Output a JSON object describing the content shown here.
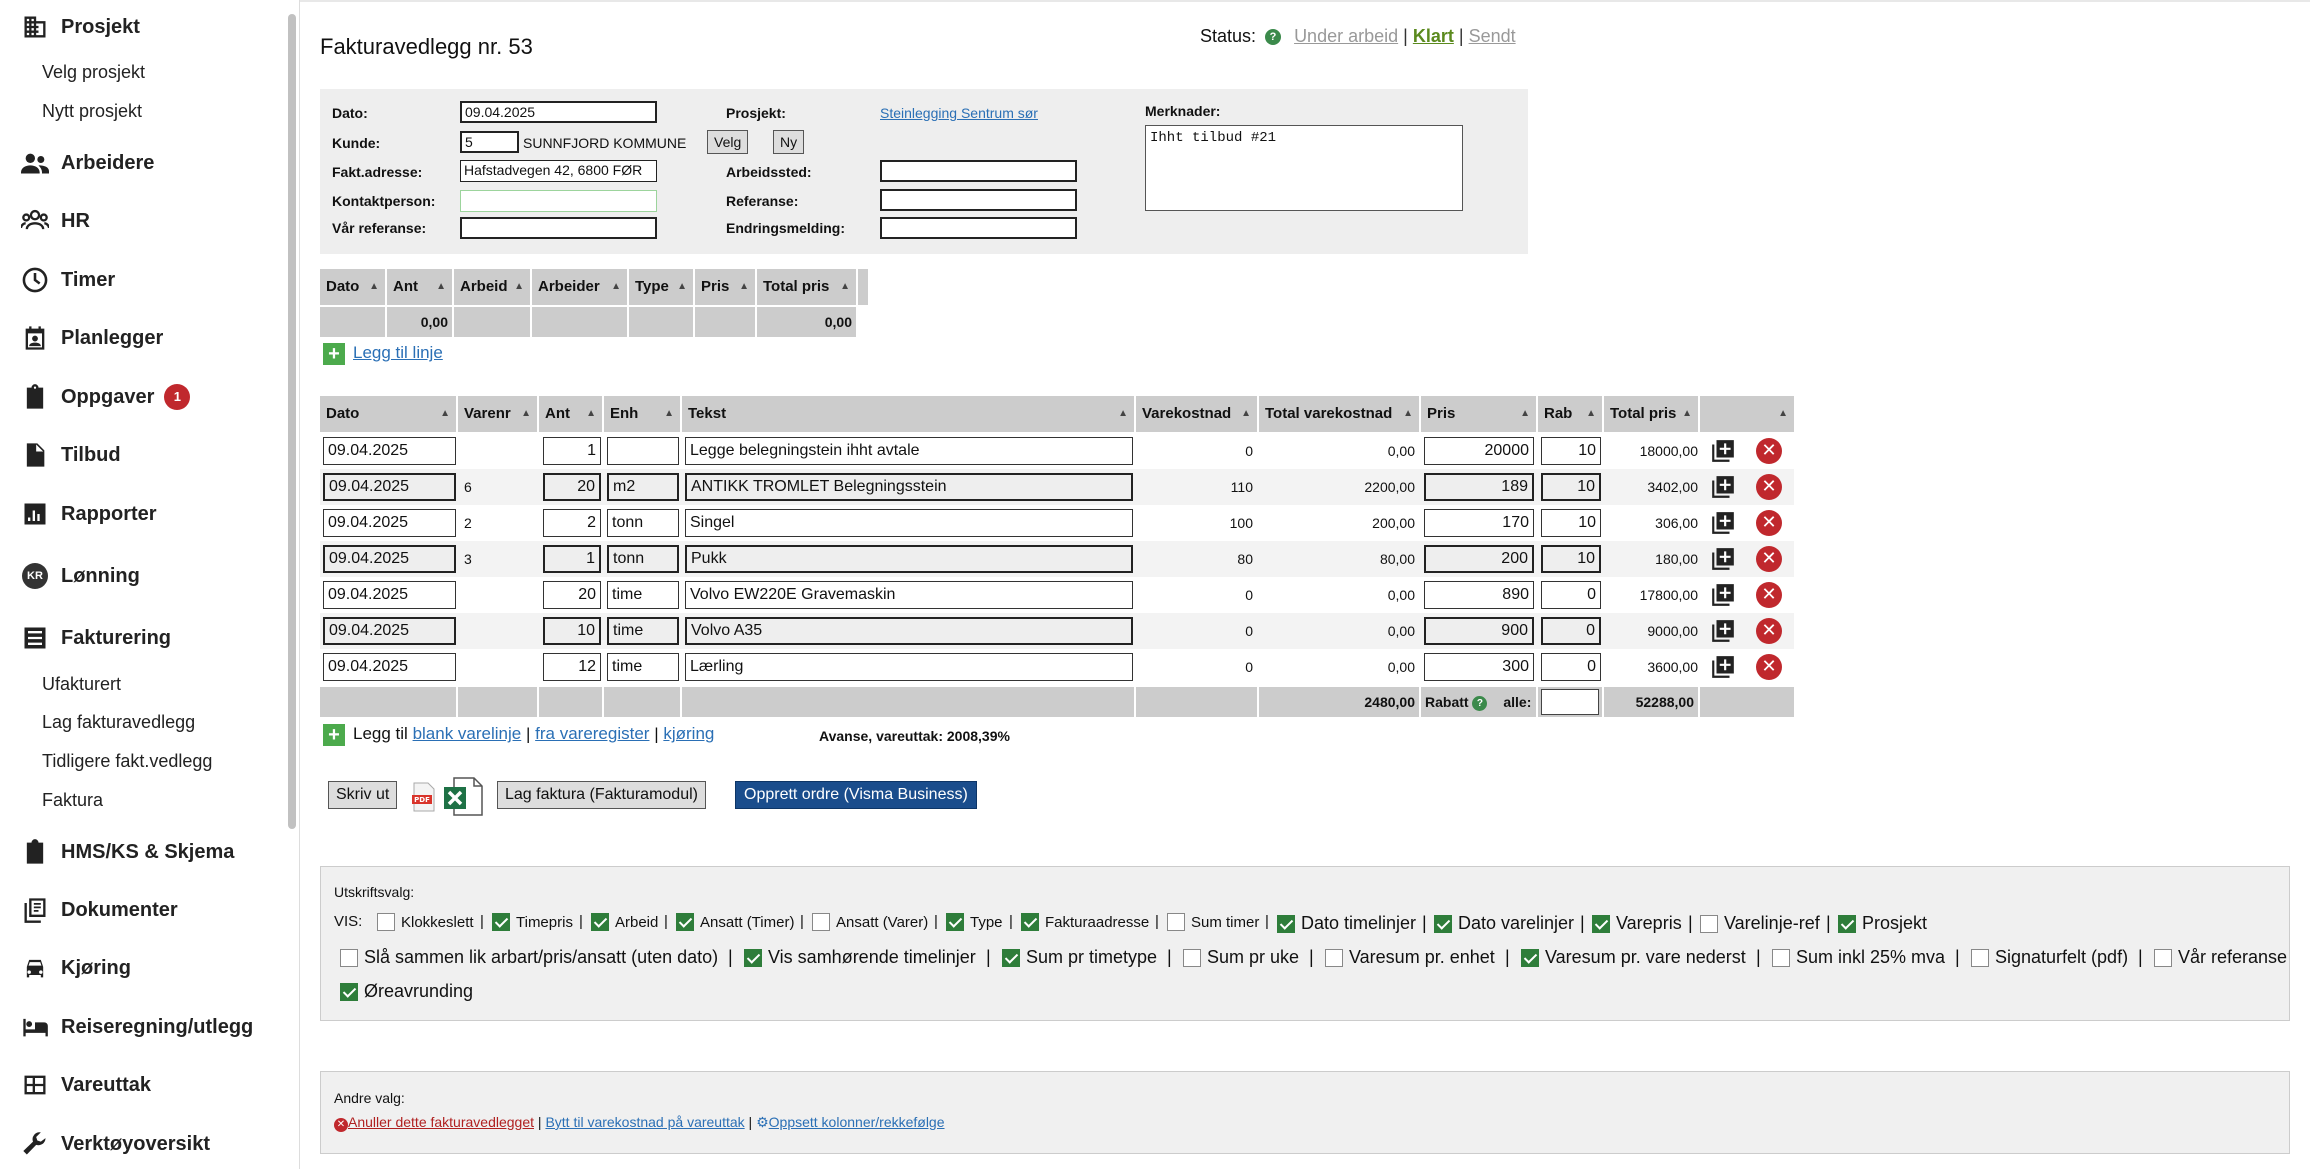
{
  "sidebar": {
    "items": [
      {
        "label": "Prosjekt",
        "icon": "building-icon"
      },
      {
        "label": "Arbeidere",
        "icon": "people-icon"
      },
      {
        "label": "HR",
        "icon": "group-icon"
      },
      {
        "label": "Timer",
        "icon": "clock-icon"
      },
      {
        "label": "Planlegger",
        "icon": "calendar-person-icon"
      },
      {
        "label": "Oppgaver",
        "icon": "task-icon",
        "badge": "1"
      },
      {
        "label": "Tilbud",
        "icon": "document-icon"
      },
      {
        "label": "Rapporter",
        "icon": "bar-chart-icon"
      },
      {
        "label": "Lønning",
        "icon": "kr-icon",
        "icon_text": "KR"
      },
      {
        "label": "Fakturering",
        "icon": "list-icon"
      },
      {
        "label": "HMS/KS & Skjema",
        "icon": "checkbox-icon"
      },
      {
        "label": "Dokumenter",
        "icon": "documents-icon"
      },
      {
        "label": "Kjøring",
        "icon": "car-icon"
      },
      {
        "label": "Reiseregning/utlegg",
        "icon": "bed-icon"
      },
      {
        "label": "Vareuttak",
        "icon": "grid-icon"
      },
      {
        "label": "Verktøyoversikt",
        "icon": "wrench-icon"
      }
    ],
    "prosjekt_sub": [
      "Velg prosjekt",
      "Nytt prosjekt"
    ],
    "fakturering_sub": [
      "Ufakturert",
      "Lag fakturavedlegg",
      "Tidligere fakt.vedlegg",
      "Faktura"
    ]
  },
  "page": {
    "title": "Fakturavedlegg nr. 53"
  },
  "status": {
    "label": "Status:",
    "help": "?",
    "options": [
      "Under arbeid",
      "Klart",
      "Sendt"
    ],
    "active": "Klart",
    "sep": "|"
  },
  "header": {
    "dato_label": "Dato:",
    "dato_value": "09.04.2025",
    "kunde_label": "Kunde:",
    "kunde_nr": "5",
    "kunde_navn": "SUNNFJORD KOMMUNE",
    "velg_btn": "Velg",
    "ny_btn": "Ny",
    "faktadresse_label": "Fakt.adresse:",
    "faktadresse_value": "Hafstadvegen 42, 6800 FØR",
    "kontaktperson_label": "Kontaktperson:",
    "kontaktperson_value": "",
    "var_referanse_label": "Vår referanse:",
    "var_referanse_value": "",
    "prosjekt_label": "Prosjekt:",
    "prosjekt_value": "Steinlegging Sentrum sør",
    "arbeidssted_label": "Arbeidssted:",
    "arbeidssted_value": "",
    "referanse_label": "Referanse:",
    "referanse_value": "",
    "endringsmelding_label": "Endringsmelding:",
    "endringsmelding_value": "",
    "merknader_label": "Merknader:",
    "merknader_value": "Ihht tilbud #21"
  },
  "time_table": {
    "headers": [
      "Dato",
      "Ant",
      "Arbeid",
      "Arbeider",
      "Type",
      "Pris",
      "Total pris"
    ],
    "sum_ant": "0,00",
    "sum_total": "0,00",
    "add_label": "Legg til linje"
  },
  "line_table": {
    "headers": [
      "Dato",
      "Varenr",
      "Ant",
      "Enh",
      "Tekst",
      "Varekostnad",
      "Total varekostnad",
      "Pris",
      "Rab",
      "Total pris",
      ""
    ],
    "rows": [
      {
        "dato": "09.04.2025",
        "varenr": "",
        "ant": "1",
        "enh": "",
        "tekst": "Legge belegningstein ihht avtale",
        "varekostnad": "0",
        "total_varekostnad": "0,00",
        "pris": "20000",
        "rab": "10",
        "total_pris": "18000,00",
        "style": "light"
      },
      {
        "dato": "09.04.2025",
        "varenr": "6",
        "ant": "20",
        "enh": "m2",
        "tekst": "ANTIKK TROMLET Belegningsstein",
        "varekostnad": "110",
        "total_varekostnad": "2200,00",
        "pris": "189",
        "rab": "10",
        "total_pris": "3402,00",
        "style": "dark"
      },
      {
        "dato": "09.04.2025",
        "varenr": "2",
        "ant": "2",
        "enh": "tonn",
        "tekst": "Singel",
        "varekostnad": "100",
        "total_varekostnad": "200,00",
        "pris": "170",
        "rab": "10",
        "total_pris": "306,00",
        "style": "light"
      },
      {
        "dato": "09.04.2025",
        "varenr": "3",
        "ant": "1",
        "enh": "tonn",
        "tekst": "Pukk",
        "varekostnad": "80",
        "total_varekostnad": "80,00",
        "pris": "200",
        "rab": "10",
        "total_pris": "180,00",
        "style": "dark"
      },
      {
        "dato": "09.04.2025",
        "varenr": "",
        "ant": "20",
        "enh": "time",
        "tekst": "Volvo EW220E Gravemaskin",
        "varekostnad": "0",
        "total_varekostnad": "0,00",
        "pris": "890",
        "rab": "0",
        "total_pris": "17800,00",
        "style": "light"
      },
      {
        "dato": "09.04.2025",
        "varenr": "",
        "ant": "10",
        "enh": "time",
        "tekst": "Volvo A35",
        "varekostnad": "0",
        "total_varekostnad": "0,00",
        "pris": "900",
        "rab": "0",
        "total_pris": "9000,00",
        "style": "dark"
      },
      {
        "dato": "09.04.2025",
        "varenr": "",
        "ant": "12",
        "enh": "time",
        "tekst": "Lærling",
        "varekostnad": "0",
        "total_varekostnad": "0,00",
        "pris": "300",
        "rab": "0",
        "total_pris": "3600,00",
        "style": "light"
      }
    ],
    "sum_total_varekostnad": "2480,00",
    "rabatt_label": "Rabatt",
    "alle_label": "alle:",
    "sum_total_pris": "52288,00",
    "add_prefix": "Legg til",
    "add_blank": "blank varelinje",
    "add_register": "fra vareregister",
    "add_kjoring": "kjøring",
    "avanse_label": "Avanse, vareuttak: 2008,39%"
  },
  "actions": {
    "skriv_ut": "Skriv ut",
    "lag_faktura": "Lag faktura (Fakturamodul)",
    "opprett_ordre": "Opprett ordre (Visma Business)",
    "pdf_text": "PDF"
  },
  "print_options": {
    "title": "Utskriftsvalg:",
    "vis_label": "VIS:",
    "sep": "|",
    "row1": [
      {
        "label": "Klokkeslett",
        "checked": false
      },
      {
        "label": "Timepris",
        "checked": true
      },
      {
        "label": "Arbeid",
        "checked": true
      },
      {
        "label": "Ansatt (Timer)",
        "checked": true
      },
      {
        "label": "Ansatt (Varer)",
        "checked": false
      },
      {
        "label": "Type",
        "checked": true
      },
      {
        "label": "Fakturaadresse",
        "checked": true
      },
      {
        "label": "Sum timer",
        "checked": false
      },
      {
        "label": "Dato timelinjer",
        "checked": true
      },
      {
        "label": "Dato varelinjer",
        "checked": true
      },
      {
        "label": "Varepris",
        "checked": true
      },
      {
        "label": "Varelinje-ref",
        "checked": false
      },
      {
        "label": "Prosjekt",
        "checked": true
      }
    ],
    "row2": [
      {
        "label": "Slå sammen lik arbart/pris/ansatt (uten dato)",
        "checked": false
      },
      {
        "label": "Vis samhørende timelinjer",
        "checked": true
      },
      {
        "label": "Sum pr timetype",
        "checked": true
      },
      {
        "label": "Sum pr uke",
        "checked": false
      },
      {
        "label": "Varesum pr. enhet",
        "checked": false
      },
      {
        "label": "Varesum pr. vare nederst",
        "checked": true
      },
      {
        "label": "Sum inkl 25% mva",
        "checked": false
      },
      {
        "label": "Signaturfelt (pdf)",
        "checked": false
      },
      {
        "label": "Vår referanse",
        "checked": false
      }
    ],
    "row3": [
      {
        "label": "Øreavrunding",
        "checked": true
      }
    ]
  },
  "andre_valg": {
    "title": "Andre valg:",
    "annuller": "Anuller dette fakturavedlegget",
    "bytt": "Bytt til varekostnad på vareuttak",
    "oppsett": "Oppsett kolonner/rekkefølge",
    "sep": "|"
  }
}
